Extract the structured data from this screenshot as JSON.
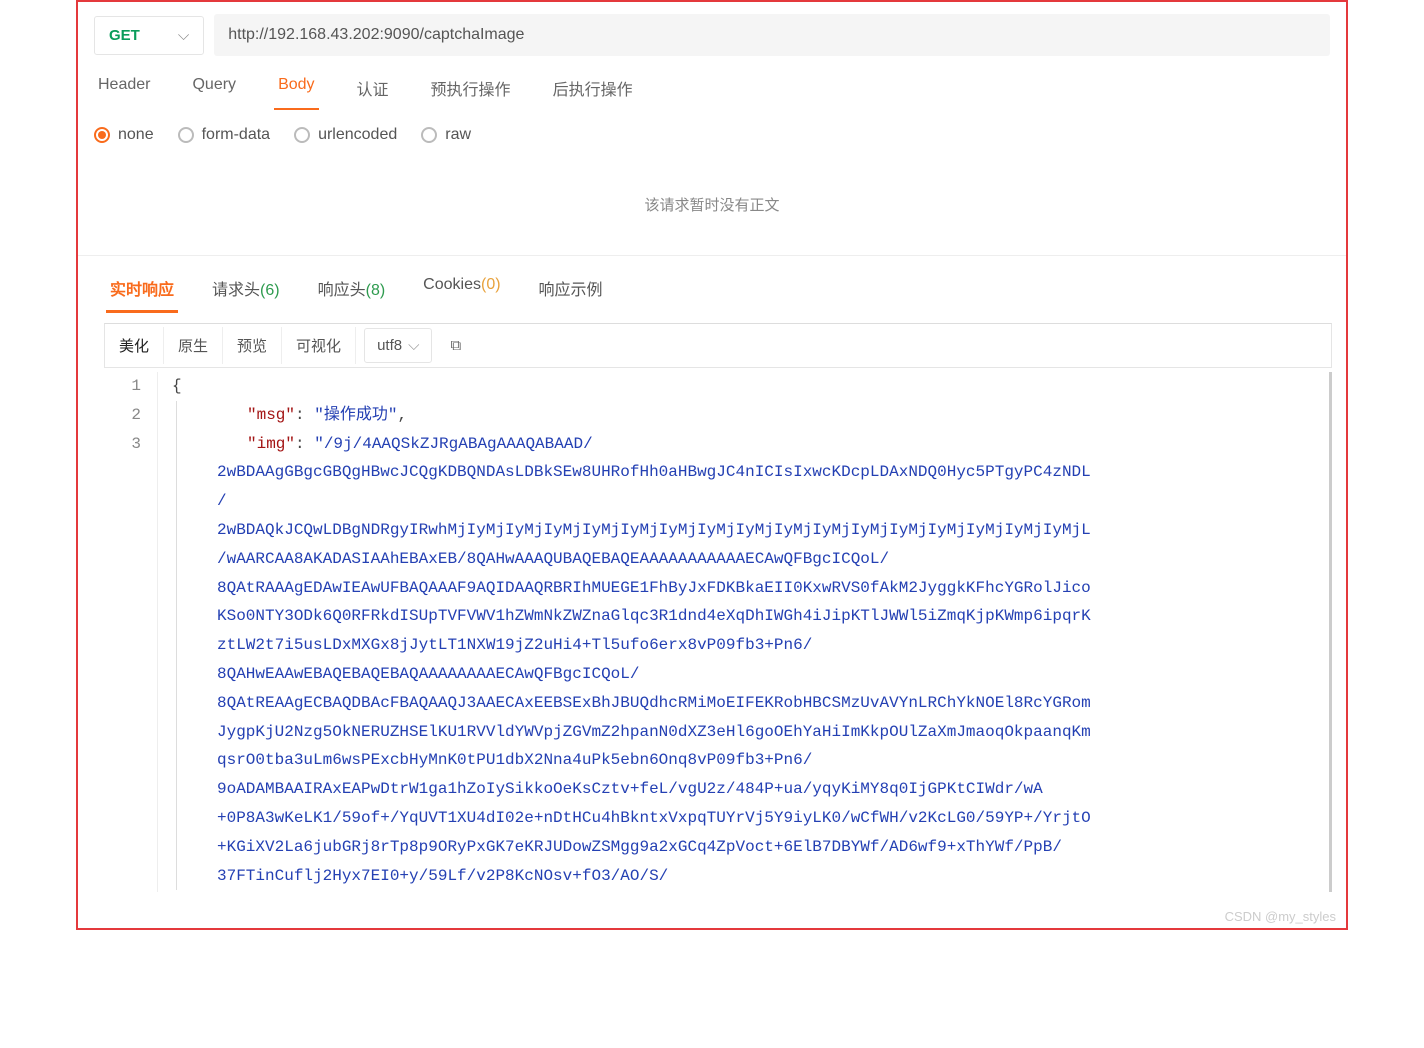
{
  "request": {
    "method": "GET",
    "url": "http://192.168.43.202:9090/captchaImage"
  },
  "tabs": {
    "header": "Header",
    "query": "Query",
    "body": "Body",
    "auth": "认证",
    "pre": "预执行操作",
    "post": "后执行操作"
  },
  "body_types": {
    "none": "none",
    "form": "form-data",
    "url": "urlencoded",
    "raw": "raw"
  },
  "empty_body_msg": "该请求暂时没有正文",
  "resp_tabs": {
    "realtime": "实时响应",
    "req_head": "请求头",
    "req_head_count": "(6)",
    "resp_head": "响应头",
    "resp_head_count": "(8)",
    "cookies": "Cookies",
    "cookies_count": "(0)",
    "example": "响应示例"
  },
  "toolbar": {
    "beautify": "美化",
    "raw": "原生",
    "preview": "预览",
    "visual": "可视化",
    "encoding": "utf8"
  },
  "response": {
    "msg_key": "\"msg\"",
    "msg_val": "\"操作成功\"",
    "img_key": "\"img\"",
    "img_val_first": "\"/9j/4AAQSkZJRgABAgAAAQABAAD/",
    "img_lines": [
      "2wBDAAgGBgcGBQgHBwcJCQgKDBQNDAsLDBkSEw8UHRofHh0aHBwgJC4nICIsIxwcKDcpLDAxNDQ0Hyc5PTgyPC4zNDL",
      "/",
      "2wBDAQkJCQwLDBgNDRgyIRwhMjIyMjIyMjIyMjIyMjIyMjIyMjIyMjIyMjIyMjIyMjIyMjIyMjIyMjIyMjIyMjIyMjL",
      "/wAARCAA8AKADASIAAhEBAxEB/8QAHwAAAQUBAQEBAQEAAAAAAAAAAAECAwQFBgcICQoL/",
      "8QAtRAAAgEDAwIEAwUFBAQAAAF9AQIDAAQRBRIhMUEGE1FhByJxFDKBkaEII0KxwRVS0fAkM2JyggkKFhcYGRolJico",
      "KSo0NTY3ODk6Q0RFRkdISUpTVFVWV1hZWmNkZWZnaGlqc3R1dnd4eXqDhIWGh4iJipKTlJWWl5iZmqKjpKWmp6ipqrK",
      "ztLW2t7i5usLDxMXGx8jJytLT1NXW19jZ2uHi4+Tl5ufo6erx8vP09fb3+Pn6/",
      "8QAHwEAAwEBAQEBAQEBAQAAAAAAAAECAwQFBgcICQoL/",
      "8QAtREAAgECBAQDBAcFBAQAAQJ3AAECAxEEBSExBhJBUQdhcRMiMoEIFEKRobHBCSMzUvAVYnLRChYkNOEl8RcYGRom",
      "JygpKjU2Nzg5OkNERUZHSElKU1RVVldYWVpjZGVmZ2hpanN0dXZ3eHl6goOEhYaHiImKkpOUlZaXmJmaoqOkpaanqKm",
      "qsrO0tba3uLm6wsPExcbHyMnK0tPU1dbX2Nna4uPk5ebn6Onq8vP09fb3+Pn6/",
      "9oADAMBAAIRAxEAPwDtrW1ga1hZoIySikkoOeKsCztv+feL/vgU2z/484P+ua/yqyKiMY8q0IjGPKtCIWdr/wA",
      "+0P8A3wKeLK1/59of+/YqUVT1XU4dI02e+nDtHCu4hBkntxVxpqTUYrVj5Y9iyLK0/wCfWH/v2KcLG0/59YP+/YrjtO",
      "+KGiXV2La6jubGRj8rTp8p9ORyPxGK7eKRJUDowZSMgg9a2xGCq4ZpVoct+6ElB7DBYWf/AD6wf9+xThYWf/PpB/",
      "37FTinCuflj2Hyx7EI0+y/59Lf/v2P8KcNOsv+fO3/AO/S/"
    ]
  },
  "watermark": "CSDN @my_styles"
}
